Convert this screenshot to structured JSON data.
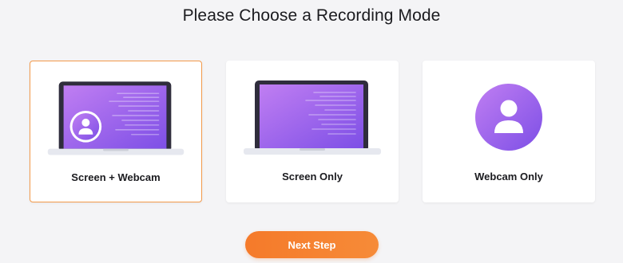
{
  "page": {
    "title": "Please Choose a Recording Mode"
  },
  "modes": [
    {
      "label": "Screen + Webcam",
      "selected": true
    },
    {
      "label": "Screen Only",
      "selected": false
    },
    {
      "label": "Webcam Only",
      "selected": false
    }
  ],
  "actions": {
    "next_label": "Next Step"
  },
  "colors": {
    "accent": "#f57a2a",
    "selected_border": "#f39a4b",
    "screen_gradient_start": "#c07ef2",
    "screen_gradient_end": "#7d4fe6"
  }
}
